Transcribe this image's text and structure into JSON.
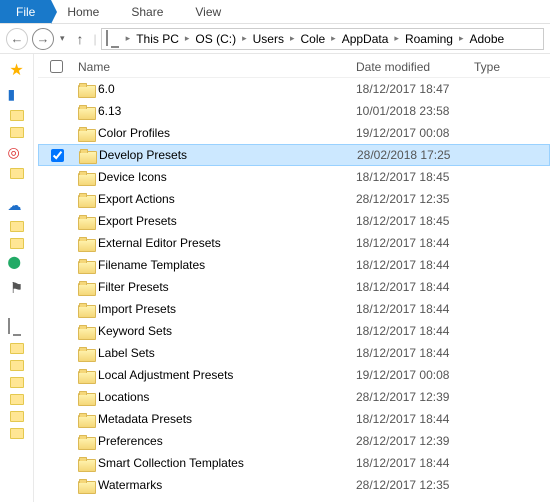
{
  "ribbon": {
    "file": "File",
    "tabs": [
      "Home",
      "Share",
      "View"
    ]
  },
  "nav": {
    "back_glyph": "←",
    "fwd_glyph": "→",
    "up_glyph": "↑",
    "caret": "▸"
  },
  "address": {
    "segments": [
      "This PC",
      "OS (C:)",
      "Users",
      "Cole",
      "AppData",
      "Roaming",
      "Adobe"
    ]
  },
  "columns": {
    "name": "Name",
    "date": "Date modified",
    "type": "Type"
  },
  "rows": [
    {
      "name": "6.0",
      "date": "18/12/2017 18:47",
      "selected": false
    },
    {
      "name": "6.13",
      "date": "10/01/2018 23:58",
      "selected": false
    },
    {
      "name": "Color Profiles",
      "date": "19/12/2017 00:08",
      "selected": false
    },
    {
      "name": "Develop Presets",
      "date": "28/02/2018 17:25",
      "selected": true
    },
    {
      "name": "Device Icons",
      "date": "18/12/2017 18:45",
      "selected": false
    },
    {
      "name": "Export Actions",
      "date": "28/12/2017 12:35",
      "selected": false
    },
    {
      "name": "Export Presets",
      "date": "18/12/2017 18:45",
      "selected": false
    },
    {
      "name": "External Editor Presets",
      "date": "18/12/2017 18:44",
      "selected": false
    },
    {
      "name": "Filename Templates",
      "date": "18/12/2017 18:44",
      "selected": false
    },
    {
      "name": "Filter Presets",
      "date": "18/12/2017 18:44",
      "selected": false
    },
    {
      "name": "Import Presets",
      "date": "18/12/2017 18:44",
      "selected": false
    },
    {
      "name": "Keyword Sets",
      "date": "18/12/2017 18:44",
      "selected": false
    },
    {
      "name": "Label Sets",
      "date": "18/12/2017 18:44",
      "selected": false
    },
    {
      "name": "Local Adjustment Presets",
      "date": "19/12/2017 00:08",
      "selected": false
    },
    {
      "name": "Locations",
      "date": "28/12/2017 12:39",
      "selected": false
    },
    {
      "name": "Metadata Presets",
      "date": "18/12/2017 18:44",
      "selected": false
    },
    {
      "name": "Preferences",
      "date": "28/12/2017 12:39",
      "selected": false
    },
    {
      "name": "Smart Collection Templates",
      "date": "18/12/2017 18:44",
      "selected": false
    },
    {
      "name": "Watermarks",
      "date": "28/12/2017 12:35",
      "selected": false
    }
  ]
}
